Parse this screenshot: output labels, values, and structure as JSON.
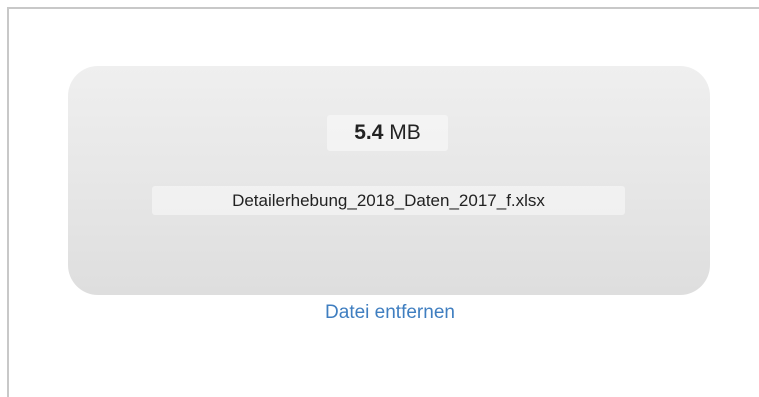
{
  "file": {
    "size_value": "5.4",
    "size_unit": "MB",
    "name": "Detailerhebung_2018_Daten_2017_f.xlsx"
  },
  "actions": {
    "remove_label": "Datei entfernen"
  },
  "colors": {
    "link": "#3f7ec0",
    "preview_bg": "#e6e6e6",
    "border": "#c8c8c8"
  }
}
